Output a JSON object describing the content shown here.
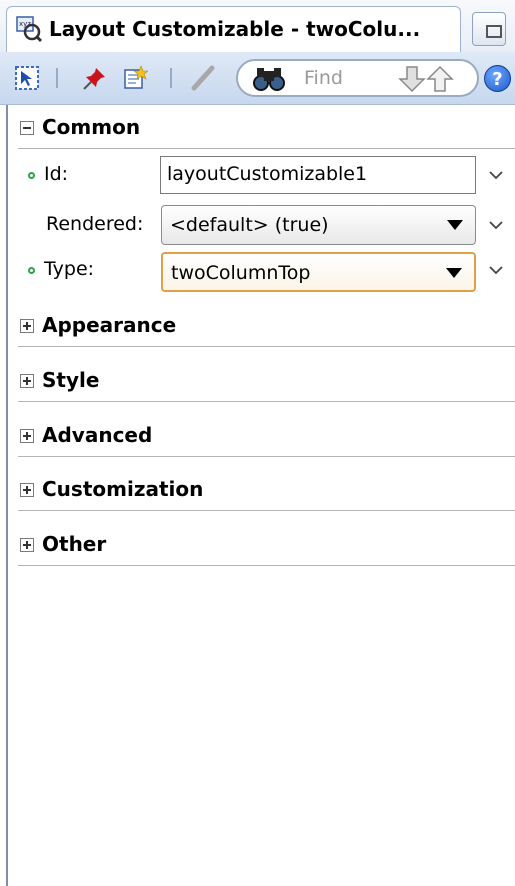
{
  "window": {
    "title": "Layout Customizable - twoColu..."
  },
  "toolbar": {
    "find_placeholder": "Find",
    "help_label": "?"
  },
  "sections": {
    "common": {
      "label": "Common",
      "expanded": true
    },
    "appearance": {
      "label": "Appearance"
    },
    "style": {
      "label": "Style"
    },
    "advanced": {
      "label": "Advanced"
    },
    "customization": {
      "label": "Customization"
    },
    "other": {
      "label": "Other"
    }
  },
  "properties": {
    "id": {
      "label": "Id:",
      "value": "layoutCustomizable1"
    },
    "rendered": {
      "label": "Rendered:",
      "value": "<default> (true)"
    },
    "type": {
      "label": "Type:",
      "value": "twoColumnTop"
    }
  },
  "colors": {
    "toolbar_bg": "#c7d7ee",
    "required_dot": "#2aa34a",
    "active_combo_border": "#e0a047"
  }
}
